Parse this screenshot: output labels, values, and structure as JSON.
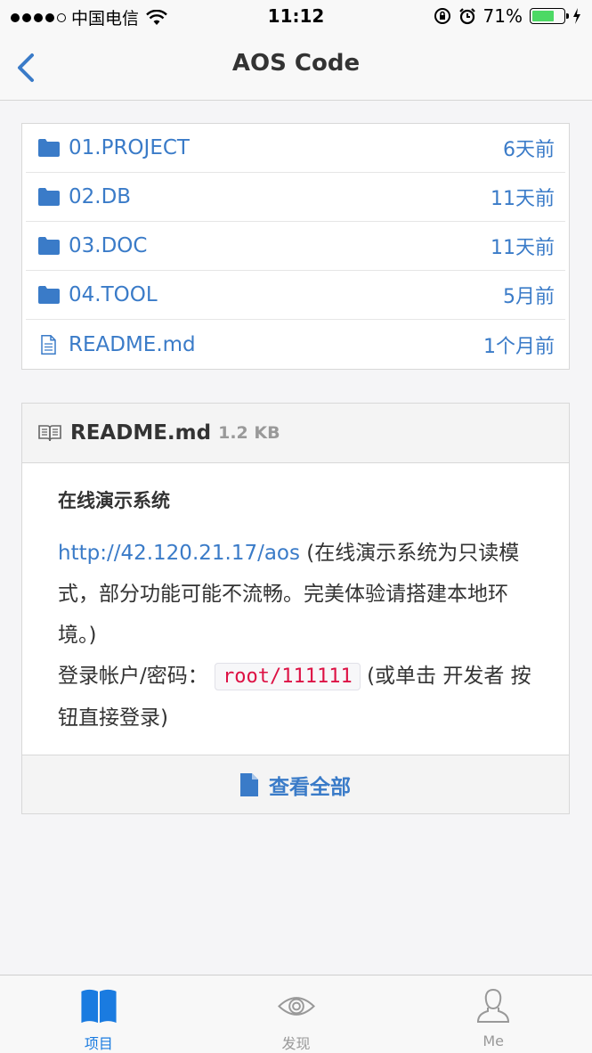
{
  "status_bar": {
    "carrier": "中国电信",
    "time": "11:12",
    "battery_percent": "71%",
    "battery_level": 0.71
  },
  "nav": {
    "title": "AOS Code"
  },
  "files": [
    {
      "name": "01.PROJECT",
      "type": "folder",
      "time": "6天前"
    },
    {
      "name": "02.DB",
      "type": "folder",
      "time": "11天前"
    },
    {
      "name": "03.DOC",
      "type": "folder",
      "time": "11天前"
    },
    {
      "name": "04.TOOL",
      "type": "folder",
      "time": "5月前"
    },
    {
      "name": "README.md",
      "type": "file",
      "time": "1个月前"
    }
  ],
  "readme": {
    "filename": "README.md",
    "size": "1.2 KB",
    "heading": "在线演示系统",
    "link": "http://42.120.21.17/aos",
    "text1": " (在线演示系统为只读模式，部分功能可能不流畅。完美体验请搭建本地环境。)",
    "login_label": "登录帐户/密码：",
    "login_code": "root/111111",
    "text2": " (或单击 开发者 按钮直接登录)",
    "view_all": "查看全部"
  },
  "tabs": [
    {
      "label": "项目",
      "icon": "book-icon",
      "active": true
    },
    {
      "label": "发现",
      "icon": "eye-icon",
      "active": false
    },
    {
      "label": "Me",
      "icon": "person-icon",
      "active": false
    }
  ],
  "colors": {
    "accent": "#3a7bc8",
    "tab_active": "#1a7be0",
    "code": "#d14"
  }
}
